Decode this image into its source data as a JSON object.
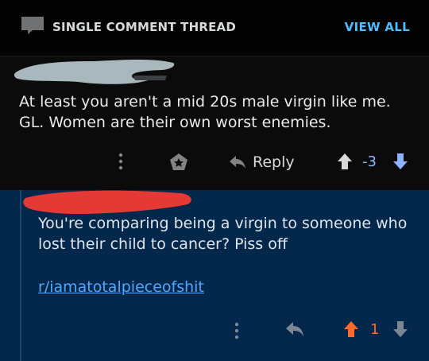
{
  "header": {
    "title": "SINGLE COMMENT THREAD",
    "view_all": "VIEW ALL",
    "icon": "comment-icon"
  },
  "comment1": {
    "body": "At least you aren't a mid 20s male virgin like me. GL. Women are their own worst enemies.",
    "actions": {
      "more_icon": "more-vertical-icon",
      "award_icon": "award-icon",
      "reply_label": "Reply",
      "reply_icon": "reply-arrow-icon",
      "upvote_icon": "upvote-arrow-icon",
      "score": "-3",
      "downvote_icon": "downvote-arrow-icon",
      "vote_state": "downvoted"
    }
  },
  "comment2": {
    "body": "You're comparing being a virgin to someone who lost their child to cancer? Piss off",
    "link": "r/iamatotalpieceofshit",
    "actions": {
      "more_icon": "more-vertical-icon",
      "reply_icon": "reply-arrow-icon",
      "upvote_icon": "upvote-arrow-icon",
      "score": "1",
      "downvote_icon": "downvote-arrow-icon",
      "vote_state": "upvoted"
    }
  },
  "colors": {
    "accent_blue": "#4fbcff",
    "downvote": "#8fb4ff",
    "upvote": "#ff6a2a",
    "highlight_bg": "#04284b",
    "redaction_gray": "#a9b8bd",
    "redaction_red": "#e53935"
  }
}
